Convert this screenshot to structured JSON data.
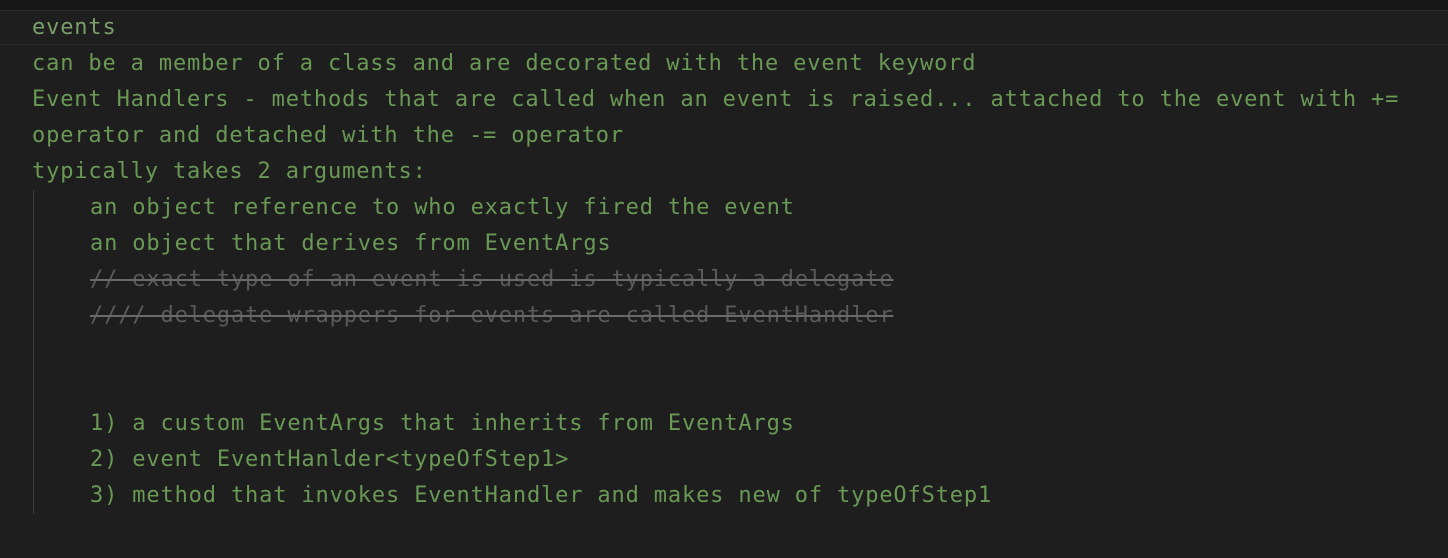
{
  "editor": {
    "lines": [
      {
        "text": "events"
      },
      {
        "text": "can be a member of a class and are decorated with the event keyword"
      },
      {
        "text": "Event Handlers - methods that are called when an event is raised... attached to the event with +="
      },
      {
        "text": "operator and detached with the -= operator"
      },
      {
        "text": "typically takes 2 arguments:"
      },
      {
        "text": "an object reference to who exactly fired the event"
      },
      {
        "text": "an object that derives from EventArgs"
      },
      {
        "text": "// exact type of an event is used is typically a delegate"
      },
      {
        "text": "//// delegate wrappers for events are called EventHandler"
      },
      {
        "text": ""
      },
      {
        "text": ""
      },
      {
        "text": "1) a custom EventArgs that inherits from EventArgs"
      },
      {
        "text": "2) event EventHanlder<typeOfStep1>"
      },
      {
        "text": "3) method that invokes EventHandler and makes new of typeOfStep1"
      }
    ]
  },
  "colors": {
    "background": "#1e1e1e",
    "comment_text": "#6a9955",
    "strikethrough_text": "#5a5a5a",
    "indent_guide": "#404040"
  }
}
